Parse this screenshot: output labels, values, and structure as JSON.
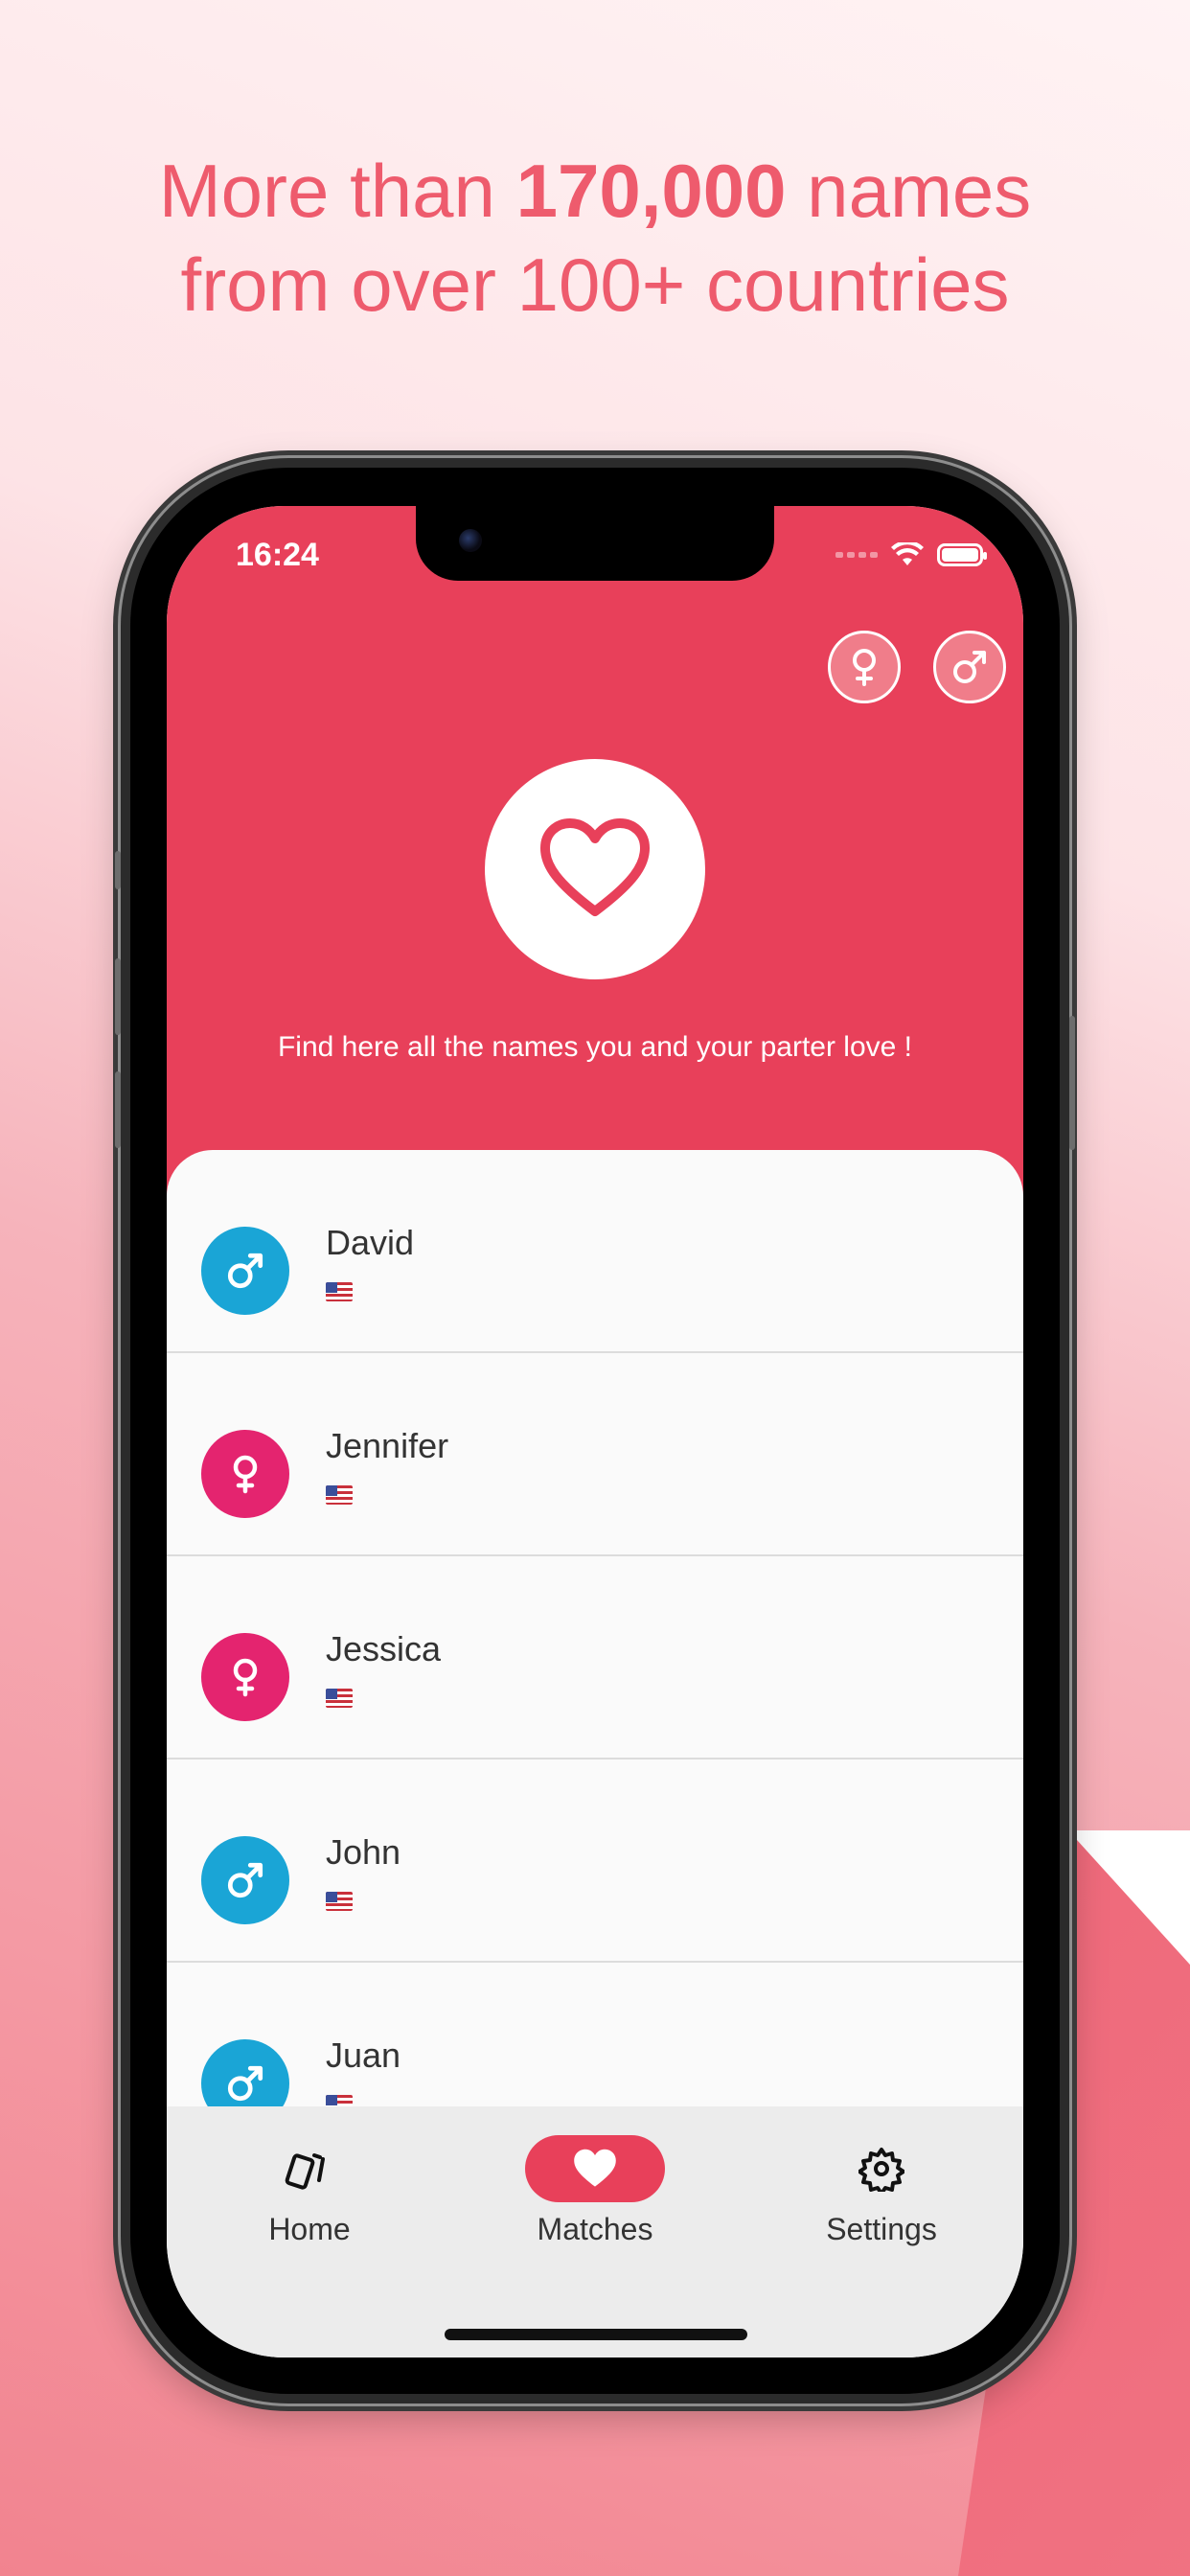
{
  "headline": {
    "line1_prefix": "More than ",
    "line1_bold": "170,000",
    "line1_suffix": " names",
    "line2": "from over 100+ countries"
  },
  "status_bar": {
    "time": "16:24"
  },
  "header": {
    "filter_buttons": [
      {
        "icon": "female-icon"
      },
      {
        "icon": "male-icon"
      }
    ],
    "center_icon": "heart-icon",
    "tagline": "Find here all the names you and your parter love !"
  },
  "matches": [
    {
      "name": "David",
      "gender": "male",
      "flag": "us-flag-icon"
    },
    {
      "name": "Jennifer",
      "gender": "female",
      "flag": "us-flag-icon"
    },
    {
      "name": "Jessica",
      "gender": "female",
      "flag": "us-flag-icon"
    },
    {
      "name": "John",
      "gender": "male",
      "flag": "us-flag-icon"
    },
    {
      "name": "Juan",
      "gender": "male",
      "flag": "us-flag-icon"
    }
  ],
  "tabbar": {
    "tabs": [
      {
        "label": "Home",
        "icon": "cards-icon",
        "active": false
      },
      {
        "label": "Matches",
        "icon": "heart-icon",
        "active": true
      },
      {
        "label": "Settings",
        "icon": "gear-icon",
        "active": false
      }
    ]
  },
  "colors": {
    "primary": "#e8405a",
    "male": "#1aa5d6",
    "female": "#e4246f",
    "headline": "#ee5b6d"
  }
}
